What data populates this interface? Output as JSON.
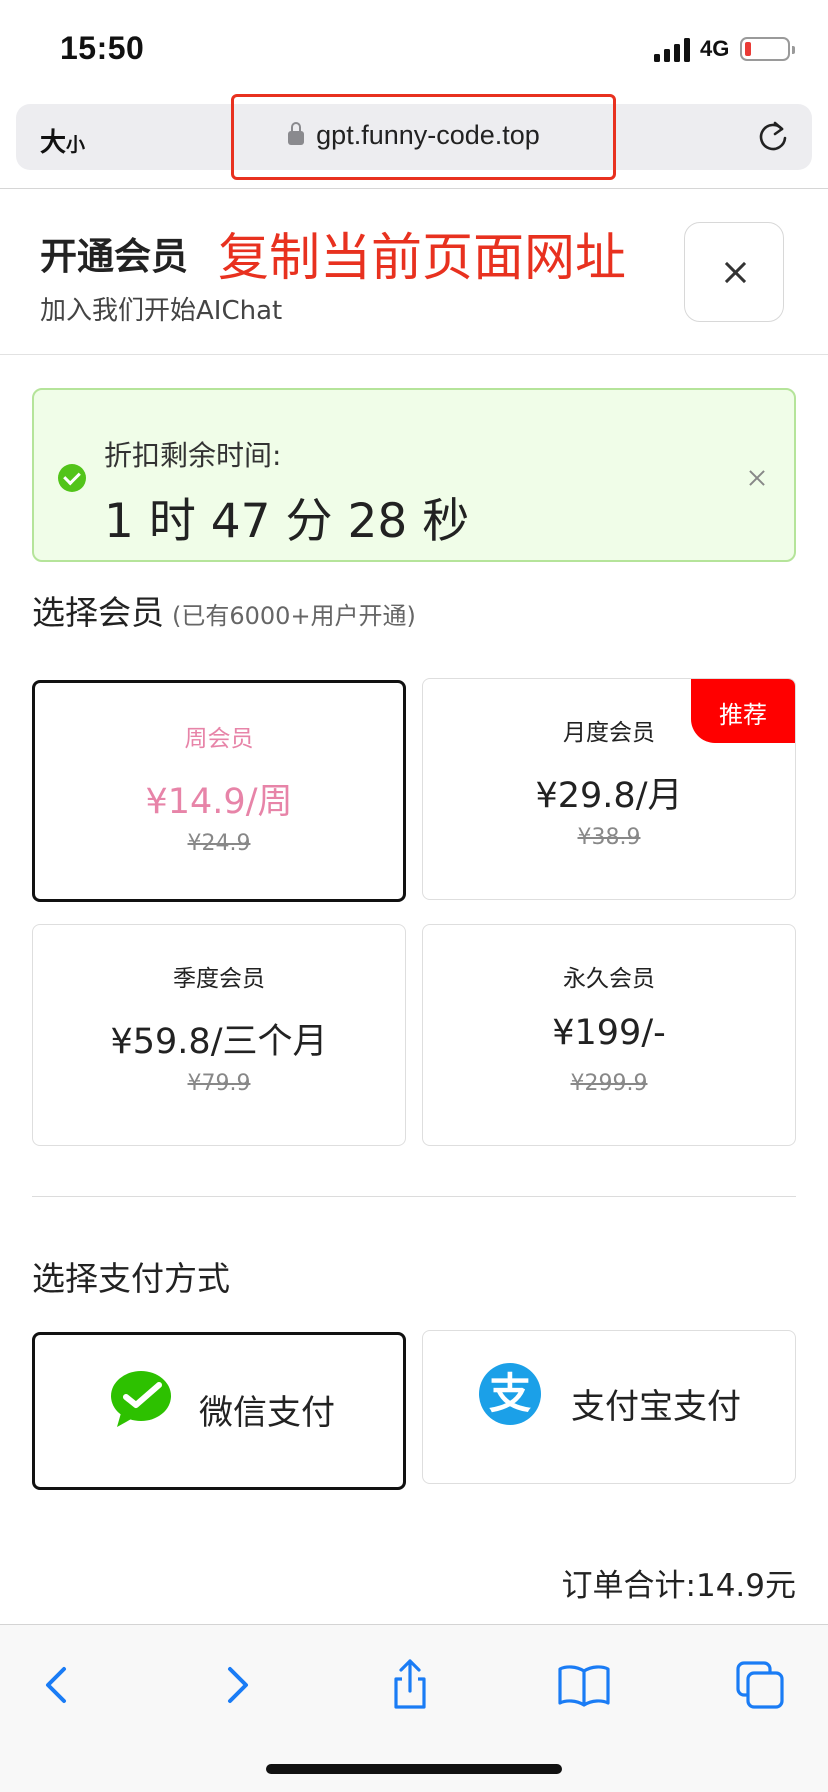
{
  "status_bar": {
    "time": "15:50",
    "network": "4G",
    "battery_level": 0.12
  },
  "browser": {
    "text_size_label_big": "大",
    "text_size_label_small": "小",
    "url": "gpt.funny-code.top",
    "reload_icon": "reload-icon"
  },
  "header": {
    "title": "开通会员",
    "annotation": "复制当前页面网址",
    "subtitle": "加入我们开始AIChat",
    "close_icon": "close-icon"
  },
  "discount": {
    "label": "折扣剩余时间:",
    "countdown": "1 时 47 分 28 秒",
    "color": "#52c41a"
  },
  "plans_section": {
    "title": "选择会员",
    "hint": "(已有6000+用户开通)",
    "plans": [
      {
        "name": "周会员",
        "price": "¥14.9/周",
        "original": "¥24.9",
        "selected": true
      },
      {
        "name": "月度会员",
        "price": "¥29.8/月",
        "original": "¥38.9",
        "badge": "推荐"
      },
      {
        "name": "季度会员",
        "price": "¥59.8/三个月",
        "original": "¥79.9"
      },
      {
        "name": "永久会员",
        "price": "¥199/-",
        "original": "¥299.9"
      }
    ]
  },
  "payment_section": {
    "title": "选择支付方式",
    "methods": [
      {
        "label": "微信支付",
        "icon": "wechat-icon",
        "selected": true
      },
      {
        "label": "支付宝支付",
        "icon": "alipay-icon"
      }
    ],
    "alipay_glyph": "支"
  },
  "order": {
    "total": "订单合计:14.9元"
  },
  "colors": {
    "accent_pink": "#e784a8",
    "badge_red": "#ff0000",
    "annotation_red": "#e8311f",
    "ios_blue": "#1a7cf5"
  }
}
